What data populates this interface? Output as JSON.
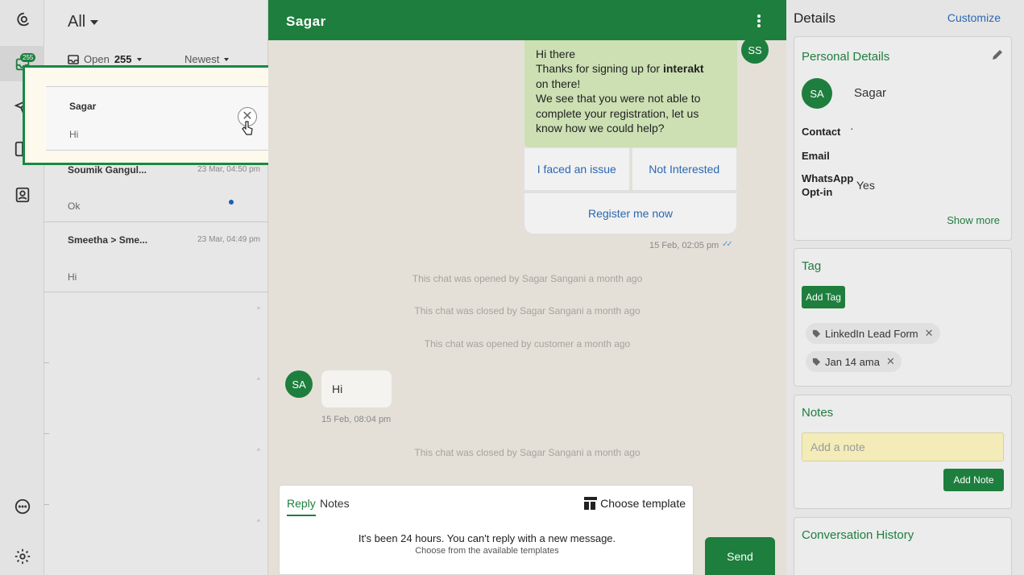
{
  "rail": {
    "badge": "255",
    "items": [
      "logo",
      "inbox",
      "campaigns",
      "layout",
      "contacts"
    ],
    "bottom": [
      "chat",
      "settings"
    ]
  },
  "list": {
    "filter": "All",
    "status_label": "Open",
    "status_count": "255",
    "sort_label": "Newest",
    "conversations": [
      {
        "name": "Soumik Gangul...",
        "time": "23 Mar, 04:50 pm",
        "message": "Ok",
        "unread": true
      },
      {
        "name": "Smeetha > Sme...",
        "time": "23 Mar, 04:49 pm",
        "message": "Hi",
        "unread": false
      }
    ],
    "tick_glyph": "^"
  },
  "popup": {
    "name": "Sagar",
    "message": "Hi",
    "close_glyph": "✕",
    "highlight_color": "#168a43"
  },
  "chat": {
    "title": "Sagar",
    "outgoing_avatar": "SS",
    "incoming_avatar": "SA",
    "outgoing": {
      "line1": "Hi there",
      "line2_pre": "Thanks for signing up for ",
      "line2_bold": "interakt",
      "line3": "on there!",
      "line4": "We see that you were not able to complete your registration, let us know how we could help?",
      "time": "15 Feb, 02:05 pm",
      "read_glyph": "✓✓"
    },
    "quick_replies": [
      "I faced an issue",
      "Not Interested",
      "Register me now"
    ],
    "system_messages": [
      "This chat was opened by Sagar Sangani a month ago",
      "This chat was closed by Sagar Sangani a month ago",
      "This chat was opened by customer a month ago",
      "This chat was closed by Sagar Sangani a month ago"
    ],
    "incoming": {
      "text": "Hi",
      "time": "15 Feb, 08:04 pm"
    },
    "accent": "#1e7e3e"
  },
  "reply": {
    "tab_reply": "Reply",
    "tab_notes": "Notes",
    "choose_template": "Choose template",
    "notice": "It's been 24 hours. You can't reply with a new message.",
    "sub_notice": "Choose from the available templates",
    "send": "Send"
  },
  "details": {
    "title": "Details",
    "customize": "Customize",
    "personal": {
      "title": "Personal Details",
      "avatar": "SA",
      "name": "Sagar",
      "contact_label": "Contact",
      "contact_value": "·",
      "email_label": "Email",
      "optin_label": "WhatsApp Opt-in",
      "optin_value": "Yes",
      "show_more": "Show more"
    },
    "tag": {
      "title": "Tag",
      "add": "Add Tag",
      "chips": [
        "LinkedIn Lead Form",
        "Jan 14 ama"
      ],
      "remove_glyph": "✕"
    },
    "notes": {
      "title": "Notes",
      "placeholder": "Add a note",
      "add": "Add Note"
    },
    "history": {
      "title": "Conversation History"
    }
  }
}
